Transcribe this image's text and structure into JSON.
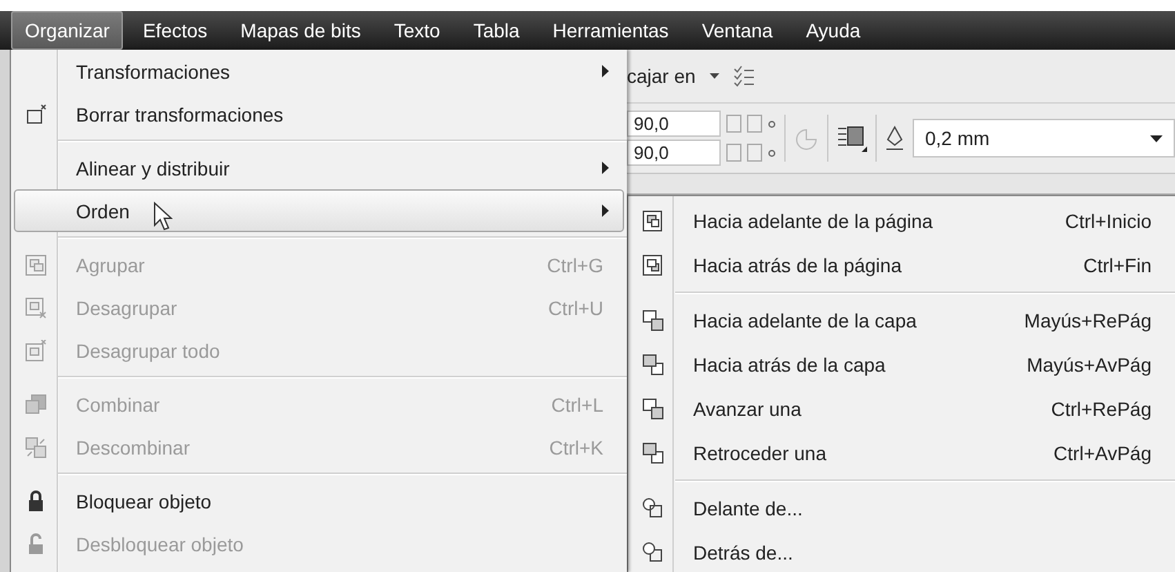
{
  "menubar": [
    {
      "label": "Organizar",
      "selected": true
    },
    {
      "label": "Efectos",
      "selected": false
    },
    {
      "label": "Mapas de bits",
      "selected": false
    },
    {
      "label": "Texto",
      "selected": false
    },
    {
      "label": "Tabla",
      "selected": false
    },
    {
      "label": "Herramientas",
      "selected": false
    },
    {
      "label": "Ventana",
      "selected": false
    },
    {
      "label": "Ayuda",
      "selected": false
    }
  ],
  "toolbar": {
    "snap_label": "cajar en",
    "angle_fields": [
      "90,0",
      "90,0"
    ],
    "outline_width": "0,2 mm"
  },
  "menu": {
    "items": [
      {
        "kind": "item",
        "label": "Transformaciones",
        "disabled": false,
        "selected": false,
        "submenu": true
      },
      {
        "kind": "item",
        "label": "Borrar transformaciones",
        "disabled": false,
        "selected": false,
        "submenu": false
      },
      {
        "kind": "separator"
      },
      {
        "kind": "item",
        "label": "Alinear y distribuir",
        "disabled": false,
        "selected": false,
        "submenu": true
      },
      {
        "kind": "item",
        "label": "Orden",
        "disabled": false,
        "selected": true,
        "submenu": true
      },
      {
        "kind": "separator"
      },
      {
        "kind": "item",
        "label": "Agrupar",
        "shortcut": "Ctrl+G",
        "disabled": true,
        "selected": false,
        "submenu": false
      },
      {
        "kind": "item",
        "label": "Desagrupar",
        "shortcut": "Ctrl+U",
        "disabled": true,
        "selected": false,
        "submenu": false
      },
      {
        "kind": "item",
        "label": "Desagrupar todo",
        "disabled": true,
        "selected": false,
        "submenu": false
      },
      {
        "kind": "separator"
      },
      {
        "kind": "item",
        "label": "Combinar",
        "shortcut": "Ctrl+L",
        "disabled": true,
        "selected": false,
        "submenu": false
      },
      {
        "kind": "item",
        "label": "Descombinar",
        "shortcut": "Ctrl+K",
        "disabled": true,
        "selected": false,
        "submenu": false
      },
      {
        "kind": "separator"
      },
      {
        "kind": "item",
        "label": "Bloquear objeto",
        "disabled": false,
        "selected": false,
        "submenu": false
      },
      {
        "kind": "item",
        "label": "Desbloquear objeto",
        "disabled": true,
        "selected": false,
        "submenu": false
      }
    ]
  },
  "submenu": {
    "items": [
      {
        "kind": "item",
        "label": "Hacia adelante de la página",
        "shortcut": "Ctrl+Inicio"
      },
      {
        "kind": "item",
        "label": "Hacia atrás de la página",
        "shortcut": "Ctrl+Fin"
      },
      {
        "kind": "separator"
      },
      {
        "kind": "item",
        "label": "Hacia adelante de la capa",
        "shortcut": "Mayús+RePág"
      },
      {
        "kind": "item",
        "label": "Hacia atrás de la capa",
        "shortcut": "Mayús+AvPág"
      },
      {
        "kind": "item",
        "label": "Avanzar una",
        "shortcut": "Ctrl+RePág"
      },
      {
        "kind": "item",
        "label": "Retroceder una",
        "shortcut": "Ctrl+AvPág"
      },
      {
        "kind": "separator"
      },
      {
        "kind": "item",
        "label": "Delante de..."
      },
      {
        "kind": "item",
        "label": "Detrás de..."
      }
    ]
  }
}
